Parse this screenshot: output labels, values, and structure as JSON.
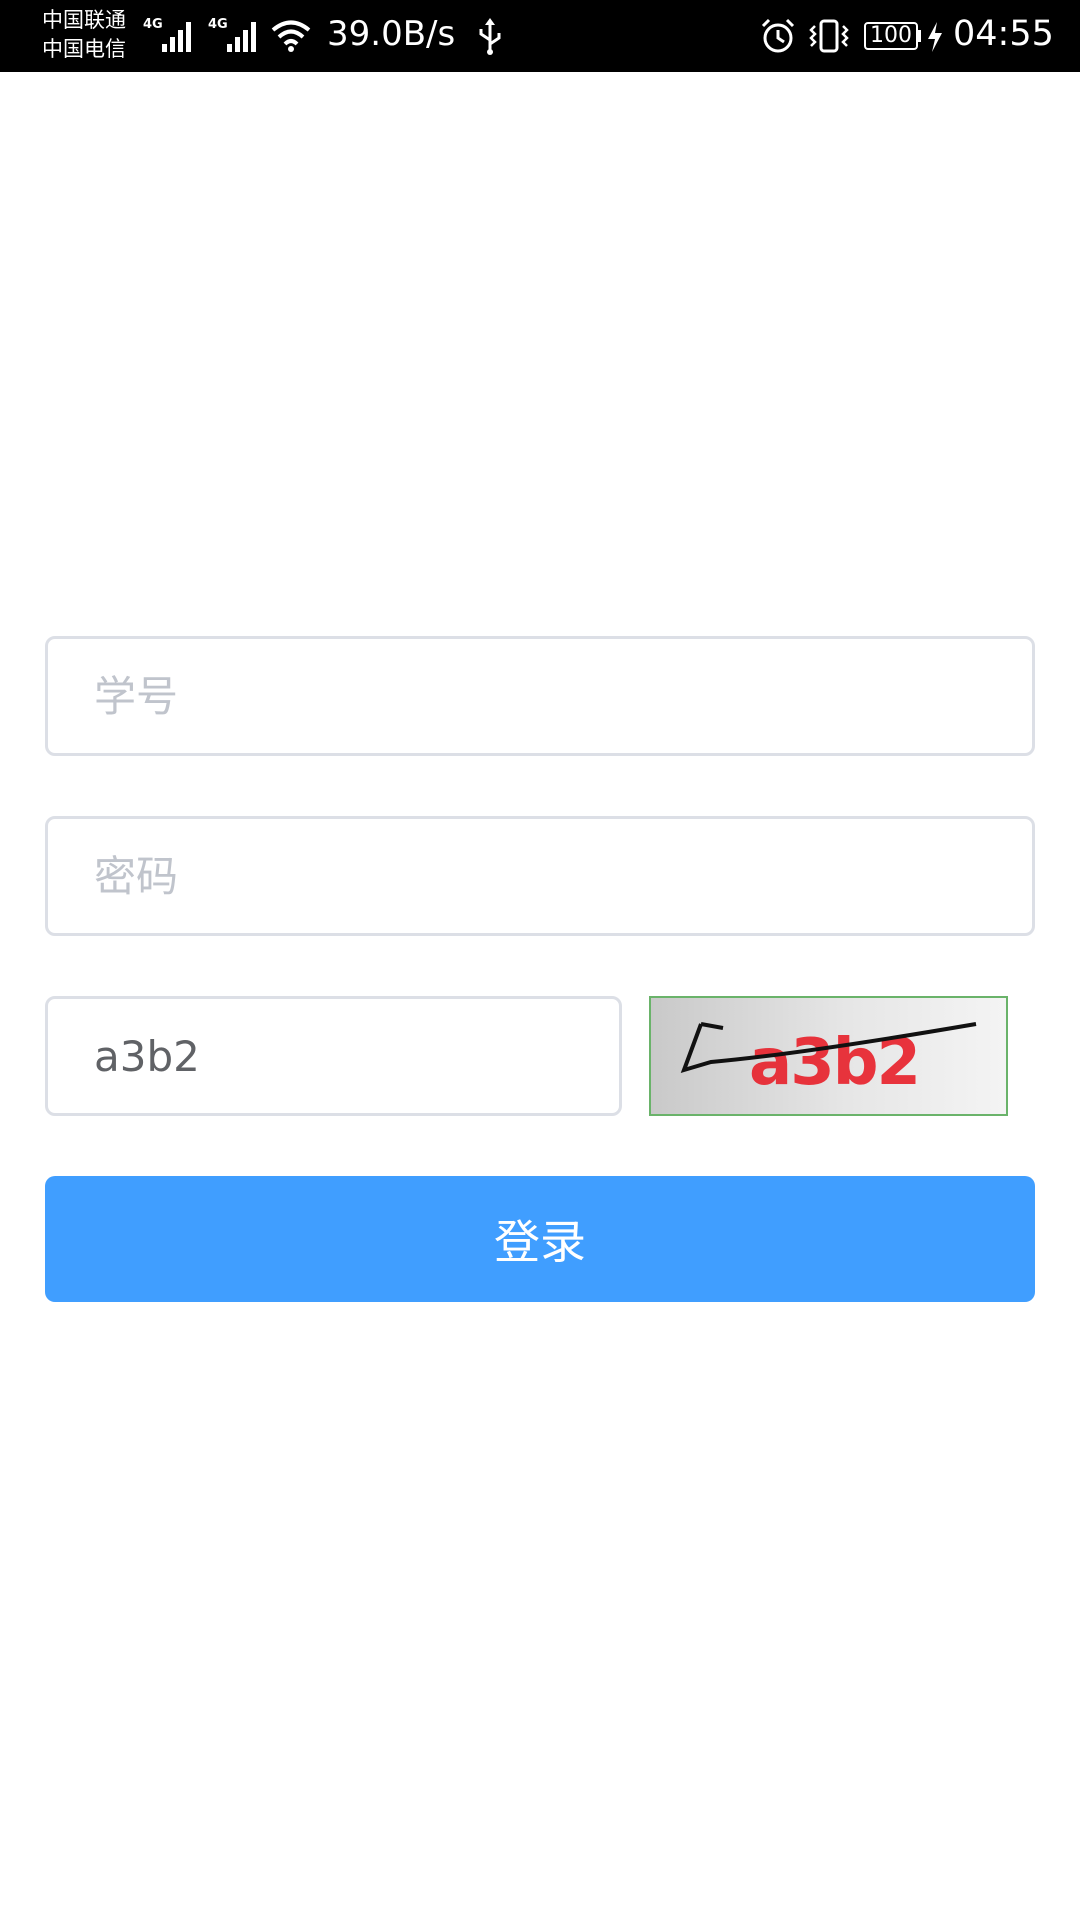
{
  "status_bar": {
    "carrier_1": "中国联通",
    "carrier_2": "中国电信",
    "signal_1_type": "4G",
    "signal_2_type": "4G",
    "net_speed": "39.0B/s",
    "battery_level": "100",
    "time": "04:55",
    "icons": [
      "signal-icon",
      "wifi-icon",
      "usb-icon",
      "alarm-icon",
      "vibrate-icon",
      "battery-icon",
      "charging-icon"
    ]
  },
  "form": {
    "student_id": {
      "placeholder": "学号",
      "value": ""
    },
    "password": {
      "placeholder": "密码",
      "value": ""
    },
    "captcha": {
      "value": "a3b2",
      "image_text": "a3b2"
    },
    "login_label": "登录"
  },
  "colors": {
    "primary": "#409eff",
    "input_border": "#dcdfe6",
    "placeholder": "#c0c4cc",
    "input_text": "#606266",
    "captcha_text": "#e8202a",
    "captcha_border": "#6ab36a"
  }
}
